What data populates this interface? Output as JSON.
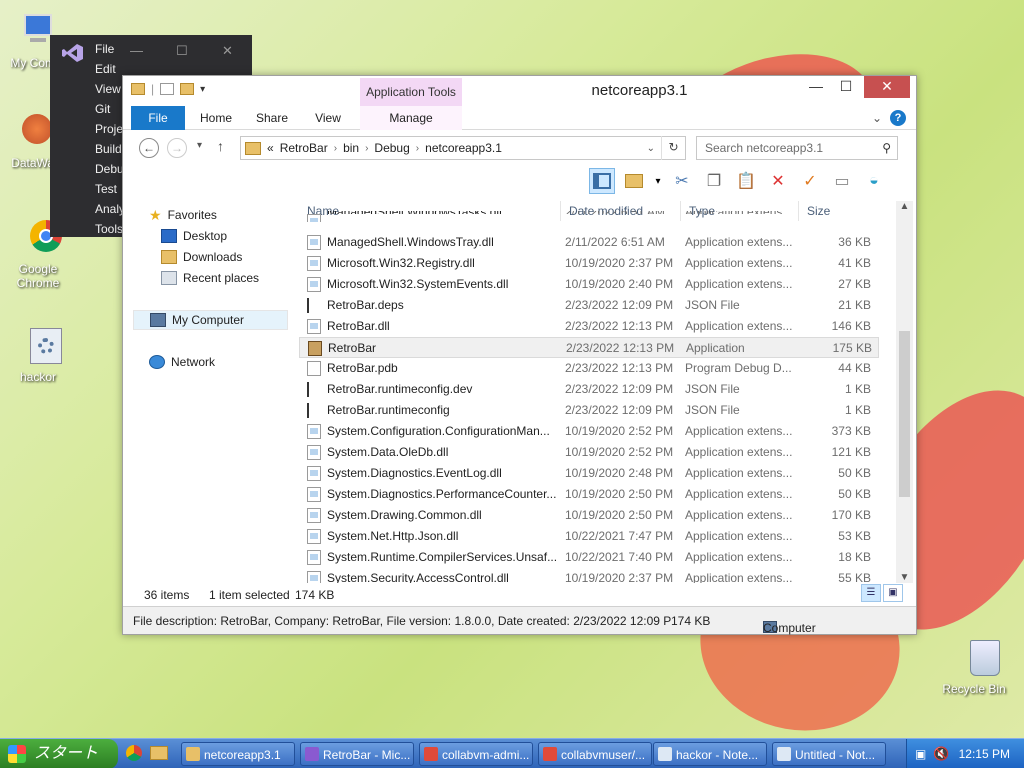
{
  "desktop": {
    "icons": [
      {
        "label": "My Comp"
      },
      {
        "label": "DataWag"
      },
      {
        "label": "Google Chrome"
      },
      {
        "label": "hackor"
      },
      {
        "label": "Recycle Bin"
      }
    ]
  },
  "vs": {
    "menu": [
      "File",
      "Edit",
      "View",
      "Git",
      "Proje",
      "Build",
      "Debu",
      "Test",
      "Analy",
      "Tools"
    ]
  },
  "explorer": {
    "title": "netcoreapp3.1",
    "context_tab_group": "Application Tools",
    "tabs": {
      "file": "File",
      "home": "Home",
      "share": "Share",
      "view": "View",
      "manage": "Manage"
    },
    "address": {
      "overflow": "«",
      "crumbs": [
        "RetroBar",
        "bin",
        "Debug",
        "netcoreapp3.1"
      ]
    },
    "search_placeholder": "Search netcoreapp3.1",
    "nav": {
      "favorites": "Favorites",
      "desktop": "Desktop",
      "downloads": "Downloads",
      "recent": "Recent places",
      "computer": "My Computer",
      "network": "Network"
    },
    "columns": {
      "name": "Name",
      "date": "Date modified",
      "type": "Type",
      "size": "Size"
    },
    "files": [
      {
        "name": "ManagedShell.WindowsTasks.dll",
        "date": "2/11/2022 6:51 AM",
        "type": "Application extens...",
        "size": "",
        "icon": "dll"
      },
      {
        "name": "ManagedShell.WindowsTray.dll",
        "date": "2/11/2022 6:51 AM",
        "type": "Application extens...",
        "size": "36 KB",
        "icon": "dll"
      },
      {
        "name": "Microsoft.Win32.Registry.dll",
        "date": "10/19/2020 2:37 PM",
        "type": "Application extens...",
        "size": "41 KB",
        "icon": "dll"
      },
      {
        "name": "Microsoft.Win32.SystemEvents.dll",
        "date": "10/19/2020 2:40 PM",
        "type": "Application extens...",
        "size": "27 KB",
        "icon": "dll"
      },
      {
        "name": "RetroBar.deps",
        "date": "2/23/2022 12:09 PM",
        "type": "JSON File",
        "size": "21 KB",
        "icon": "json"
      },
      {
        "name": "RetroBar.dll",
        "date": "2/23/2022 12:13 PM",
        "type": "Application extens...",
        "size": "146 KB",
        "icon": "dll"
      },
      {
        "name": "RetroBar",
        "date": "2/23/2022 12:13 PM",
        "type": "Application",
        "size": "175 KB",
        "icon": "app"
      },
      {
        "name": "RetroBar.pdb",
        "date": "2/23/2022 12:13 PM",
        "type": "Program Debug D...",
        "size": "44 KB",
        "icon": "file"
      },
      {
        "name": "RetroBar.runtimeconfig.dev",
        "date": "2/23/2022 12:09 PM",
        "type": "JSON File",
        "size": "1 KB",
        "icon": "json"
      },
      {
        "name": "RetroBar.runtimeconfig",
        "date": "2/23/2022 12:09 PM",
        "type": "JSON File",
        "size": "1 KB",
        "icon": "json"
      },
      {
        "name": "System.Configuration.ConfigurationMan...",
        "date": "10/19/2020 2:52 PM",
        "type": "Application extens...",
        "size": "373 KB",
        "icon": "dll"
      },
      {
        "name": "System.Data.OleDb.dll",
        "date": "10/19/2020 2:52 PM",
        "type": "Application extens...",
        "size": "121 KB",
        "icon": "dll"
      },
      {
        "name": "System.Diagnostics.EventLog.dll",
        "date": "10/19/2020 2:48 PM",
        "type": "Application extens...",
        "size": "50 KB",
        "icon": "dll"
      },
      {
        "name": "System.Diagnostics.PerformanceCounter...",
        "date": "10/19/2020 2:50 PM",
        "type": "Application extens...",
        "size": "50 KB",
        "icon": "dll"
      },
      {
        "name": "System.Drawing.Common.dll",
        "date": "10/19/2020 2:50 PM",
        "type": "Application extens...",
        "size": "170 KB",
        "icon": "dll"
      },
      {
        "name": "System.Net.Http.Json.dll",
        "date": "10/22/2021 7:47 PM",
        "type": "Application extens...",
        "size": "53 KB",
        "icon": "dll"
      },
      {
        "name": "System.Runtime.CompilerServices.Unsaf...",
        "date": "10/22/2021 7:40 PM",
        "type": "Application extens...",
        "size": "18 KB",
        "icon": "dll"
      },
      {
        "name": "System.Security.AccessControl.dll",
        "date": "10/19/2020 2:37 PM",
        "type": "Application extens...",
        "size": "55 KB",
        "icon": "dll"
      }
    ],
    "selected_index": 6,
    "status": {
      "items": "36 items",
      "selected": "1 item selected",
      "size": "174 KB"
    },
    "details": {
      "description": "File description: RetroBar, Company: RetroBar, File version: 1.8.0.0, Date created: 2/23/2022 12:09 PM, S",
      "size": "174 KB",
      "location": "Computer"
    }
  },
  "taskbar": {
    "start": "スタート",
    "buttons": [
      {
        "label": "netcoreapp3.1",
        "color": "#e8c068"
      },
      {
        "label": "RetroBar - Mic...",
        "color": "#8a5ad0"
      },
      {
        "label": "collabvm-admi...",
        "color": "#e04a3a"
      },
      {
        "label": "collabvmuser/...",
        "color": "#e04a3a"
      },
      {
        "label": "hackor - Note...",
        "color": "#dde8f4"
      },
      {
        "label": "Untitled - Not...",
        "color": "#dde8f4"
      }
    ],
    "clock": "12:15 PM"
  }
}
